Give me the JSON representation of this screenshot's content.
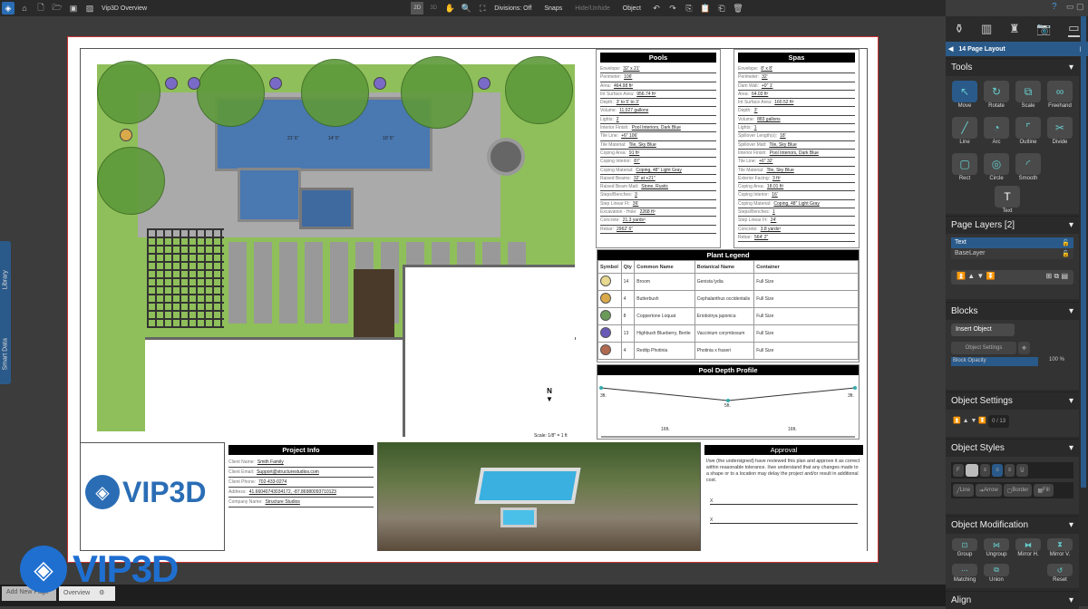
{
  "app": {
    "title": "Vip3D Overview",
    "divisions": "Divisions: Off",
    "snaps": "Snaps",
    "hide_unhide": "Hide/Unhide",
    "object": "Object",
    "view_2d": "2D",
    "view_3d": "3D"
  },
  "left_tabs": {
    "library": "Library",
    "smart_data": "Smart Data"
  },
  "bottom": {
    "add_new_page": "Add New Page",
    "overview": "Overview",
    "watermark": "VIP3D"
  },
  "pools": {
    "title": "Pools",
    "rows": [
      [
        "Envelope:",
        "32' x 21'"
      ],
      [
        "Perimeter:",
        "106'"
      ],
      [
        "Area:",
        "464.98 ft²"
      ],
      [
        "Int Surface Area:",
        "956.74 ft²"
      ],
      [
        "Depth:",
        "3' to 5' to 3'"
      ],
      [
        "Volume:",
        "11,027 gallons"
      ],
      [
        "Lights:",
        "2"
      ],
      [
        "Interior Finish:",
        "Pool Interiors, Dark Blue"
      ],
      [
        "Tile Line:",
        "+6\" 106'"
      ],
      [
        "Tile Material:",
        "Tile, Sky Blue"
      ],
      [
        "Coping Area:",
        "91 ft²"
      ],
      [
        "Coping Interior:",
        "87'"
      ],
      [
        "Coping Material:",
        "Coping, 48\" Light Gray"
      ],
      [
        "Raised Beams:",
        "32' at +21\""
      ],
      [
        "Raised Beam Matl:",
        "Stone, Rustic"
      ],
      [
        "Steps/Benches:",
        "3"
      ],
      [
        "Step Linear Ft:",
        "36'"
      ],
      [
        "Excavation - Hole:",
        "2268 ft³"
      ],
      [
        "Concrete:",
        "21.3 yards³"
      ],
      [
        "Rebar:",
        "2962' 6\""
      ]
    ]
  },
  "spas": {
    "title": "Spas",
    "rows": [
      [
        "Envelope:",
        "8' x 8'"
      ],
      [
        "Perimeter:",
        "32'"
      ],
      [
        "Dam Wall:",
        "+0\" 1'"
      ],
      [
        "Area:",
        "64.03 ft²"
      ],
      [
        "Int Surface Area:",
        "160.52 ft²"
      ],
      [
        "Depth:",
        "3'"
      ],
      [
        "Volume:",
        "883 gallons"
      ],
      [
        "Lights:",
        "1"
      ],
      [
        "Spillover Length(s):",
        "18'"
      ],
      [
        "Spillover Matl:",
        "Tile, Sky Blue"
      ],
      [
        "Interior Finish:",
        "Pool Interiors, Dark Blue"
      ],
      [
        "Tile Line:",
        "+6\" 32'"
      ],
      [
        "Tile Material:",
        "Tile, Sky Blue"
      ],
      [
        "Exterior Facing:",
        "3 ft²"
      ],
      [
        "Coping Area:",
        "18.01 ft²"
      ],
      [
        "Coping Interior:",
        "16'"
      ],
      [
        "Coping Material:",
        "Coping, 48\" Light Gray"
      ],
      [
        "Steps/Benches:",
        "1"
      ],
      [
        "Step Linear Ft:",
        "24'"
      ],
      [
        "Concrete:",
        "3.8 yards³"
      ],
      [
        "Rebar:",
        "564' 2\""
      ]
    ]
  },
  "plant_legend": {
    "title": "Plant Legend",
    "headers": [
      "Symbol",
      "Qty",
      "Common Name",
      "Botanical Name",
      "Container"
    ],
    "rows": [
      {
        "qty": "14",
        "common": "Broom",
        "botanical": "Genista lydia",
        "container": "Full Size",
        "color": "#e8d890"
      },
      {
        "qty": "4",
        "common": "Butterbush",
        "botanical": "Cephalanthus occidentalis",
        "container": "Full Size",
        "color": "#d9a94a"
      },
      {
        "qty": "8",
        "common": "Coppertone Loquat",
        "botanical": "Eriobotrya japonica",
        "container": "Full Size",
        "color": "#6a9a5a"
      },
      {
        "qty": "13",
        "common": "Highbush Blueberry, Bertie",
        "botanical": "Vaccinium corymbosum",
        "container": "Full Size",
        "color": "#6a5ab8"
      },
      {
        "qty": "4",
        "common": "Redtip Photinia",
        "botanical": "Photinia x fraseri",
        "container": "Full Size",
        "color": "#b06a50"
      }
    ]
  },
  "depth_profile": {
    "title": "Pool Depth Profile",
    "left": "3ft.",
    "mid": "5ft.",
    "right": "3ft.",
    "seg1": "16ft.",
    "seg2": "16ft."
  },
  "plan": {
    "scale": "Scale: 1/8\" = 1 ft",
    "north": "N",
    "dims": [
      "21' 6\"",
      "14' 5\"",
      "10' 5\""
    ]
  },
  "project_info": {
    "title": "Project Info",
    "rows": [
      [
        "Client Name:",
        "Smith Family"
      ],
      [
        "Client Email:",
        "Support@structurestudios.com"
      ],
      [
        "Client Phone:",
        "702-433-0274"
      ],
      [
        "Address:",
        "41.66040743034172, -87.86980093710123"
      ],
      [
        "Company Name:",
        "Structure Studios"
      ]
    ]
  },
  "logo": "VIP3D",
  "approval": {
    "title": "Approval",
    "text": "I/we (the undersigned) have reviewed this plan and approve it as correct within reasonable tolerance. I/we understand that any changes made to a shape or to a location may delay the project and/or result in additional cost.",
    "sig1": "X",
    "sig2": "X"
  },
  "rpanel": {
    "nav": "14 Page Layout",
    "tools_title": "Tools",
    "tools": [
      "Move",
      "Rotate",
      "Scale",
      "Freehand",
      "Line",
      "Arc",
      "Outline",
      "Divide",
      "Rect",
      "Circle",
      "Smooth",
      "Text"
    ],
    "layers_title": "Page Layers [2]",
    "layers": [
      "Text",
      "BaseLayer"
    ],
    "blocks_title": "Blocks",
    "insert_object": "Insert Object",
    "object_settings_btn": "Object Settings",
    "block_opacity": "Block Opacity",
    "opacity_value": "100 %",
    "opacity": 100,
    "object_settings_title": "Object Settings",
    "order": "0 / 13",
    "object_styles_title": "Object Styles",
    "styles": [
      "Line",
      "Arrow",
      "Border",
      "Fill"
    ],
    "font_btn": "F",
    "modification_title": "Object Modification",
    "mods": [
      "Group",
      "Ungroup",
      "Mirror H.",
      "Mirror V.",
      "Matching",
      "Union",
      "Reset"
    ],
    "align_title": "Align"
  },
  "colors": {
    "accent": "#2a6db5",
    "grass": "#8fbf5a",
    "pool": "#4a78b0"
  }
}
